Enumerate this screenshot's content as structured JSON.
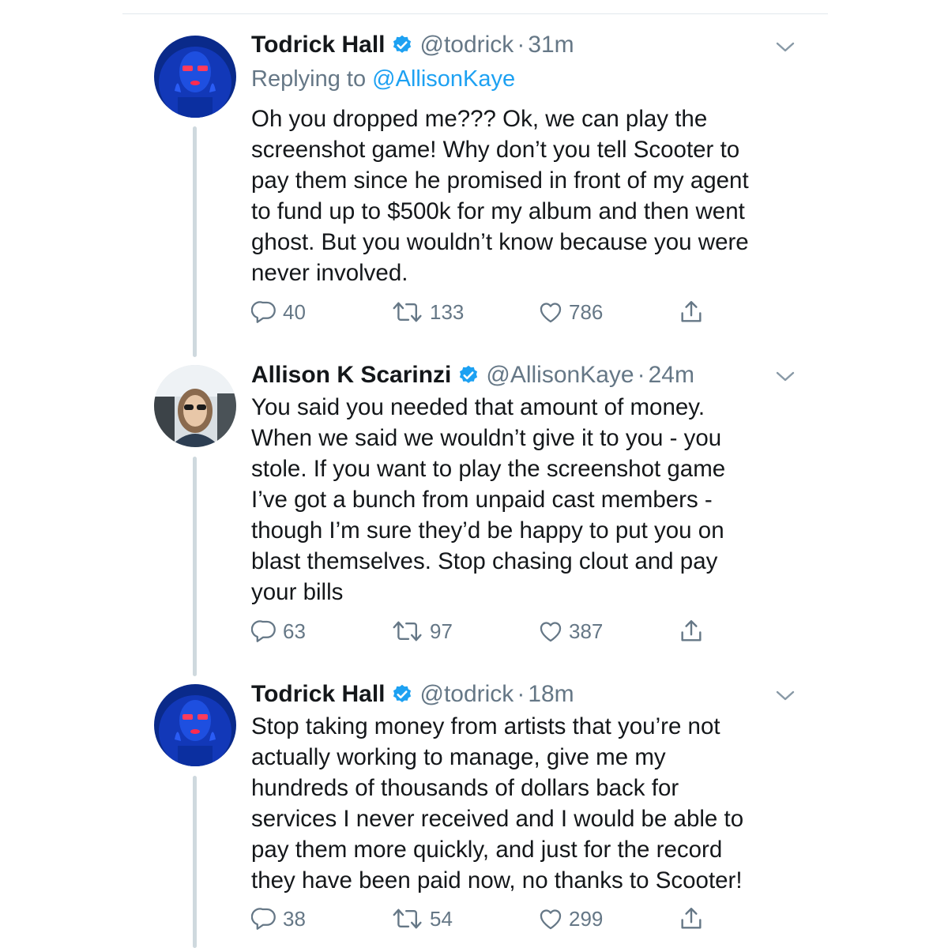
{
  "tweets": [
    {
      "name": "Todrick Hall",
      "handle": "@todrick",
      "time": "31m",
      "replying_prefix": "Replying to ",
      "replying_to": "@AllisonKaye",
      "text": "Oh you dropped me??? Ok, we can play the\nscreenshot game! Why don’t you tell Scooter to\npay them since he promised in front of my agent\nto fund up to $500k for my album and then went\nghost. But you wouldn’t know because you were\nnever involved.",
      "replies": "40",
      "retweets": "133",
      "likes": "786"
    },
    {
      "name": "Allison K Scarinzi",
      "handle": "@AllisonKaye",
      "time": "24m",
      "text": "You said you needed that amount of money.\nWhen we said we wouldn’t give it to you - you\nstole. If you want to play the screenshot game\nI’ve got a bunch from unpaid cast members -\nthough I’m sure they’d be happy to put you on\nblast themselves. Stop chasing clout and pay\nyour bills",
      "replies": "63",
      "retweets": "97",
      "likes": "387"
    },
    {
      "name": "Todrick Hall",
      "handle": "@todrick",
      "time": "18m",
      "text": "Stop taking money from artists that you’re not\nactually working to manage, give me my\nhundreds of thousands of dollars back for\nservices I never received and I would be able to\npay them more quickly, and just for the record\nthey have been paid now, no thanks to  Scooter!",
      "replies": "38",
      "retweets": "54",
      "likes": "299"
    }
  ],
  "separator": "·",
  "icons": {
    "reply": "reply-icon",
    "retweet": "retweet-icon",
    "like": "heart-icon",
    "share": "share-icon",
    "verified": "verified-badge-icon",
    "caret": "chevron-down-icon"
  },
  "colors": {
    "text": "#14171a",
    "secondary": "#657786",
    "link": "#1da1f2",
    "verified": "#1da1f2",
    "thread_line": "#cfd9de"
  }
}
